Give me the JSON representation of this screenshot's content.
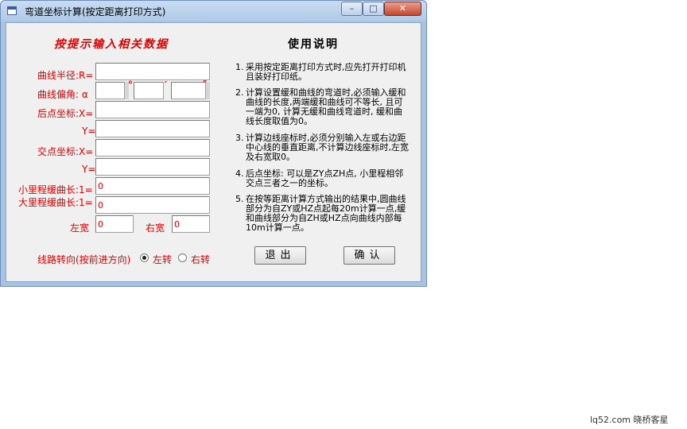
{
  "window": {
    "title": "弯道坐标计算(按定距离打印方式)",
    "min_glyph": "–",
    "max_glyph": "□",
    "close_glyph": "✕"
  },
  "form": {
    "heading": "按提示输入相关数据",
    "radius_label": "曲线半径:R=",
    "angle_label": "曲线偏角: α",
    "deg_unit": "°",
    "min_unit": "′",
    "sec_unit": "″",
    "start_x_label": "后点坐标:X=",
    "start_y_label": "Y=",
    "intersect_x_label": "交点坐标:X=",
    "intersect_y_label": "Y=",
    "small_curve_label": "小里程缓曲长:1=",
    "small_curve_value": "0",
    "large_curve_label": "大里程缓曲长:1=",
    "large_curve_value": "0",
    "left_width_label": "左宽",
    "left_width_value": "0",
    "right_width_label": "右宽",
    "right_width_value": "0",
    "direction_label": "线路转向(按前进方向)",
    "turn_left_label": "左转",
    "turn_right_label": "右转",
    "turn_selected": "left"
  },
  "help": {
    "heading": "使用说明",
    "items": [
      {
        "num": "1.",
        "text": "采用按定距离打印方式时,应先打开打印机且装好打印纸。"
      },
      {
        "num": "2.",
        "text": "计算设置缓和曲线的弯道时,必须输入缓和曲线的长度,两端缓和曲线可不等长, 且可一端为0, 计算无缓和曲线弯道时, 缓和曲线长度取值为0。"
      },
      {
        "num": "3.",
        "text": "计算边线座标时,必须分别输入左或右边距中心线的垂直距离,不计算边线座标时,左宽及右宽取0。"
      },
      {
        "num": "4.",
        "text": "后点坐标: 可以是ZY点ZH点, 小里程相邻交点三者之一的坐标。"
      },
      {
        "num": "5.",
        "text": "在按等距离计算方式输出的结果中,圆曲线部分为自ZY或HZ点起每20m计算一点,缓和曲线部分为自ZH或HZ点向曲线内部每10m计算一点。"
      }
    ]
  },
  "buttons": {
    "exit": "退出",
    "confirm": "确认"
  },
  "watermark": "lq52.com 晓桥客星"
}
